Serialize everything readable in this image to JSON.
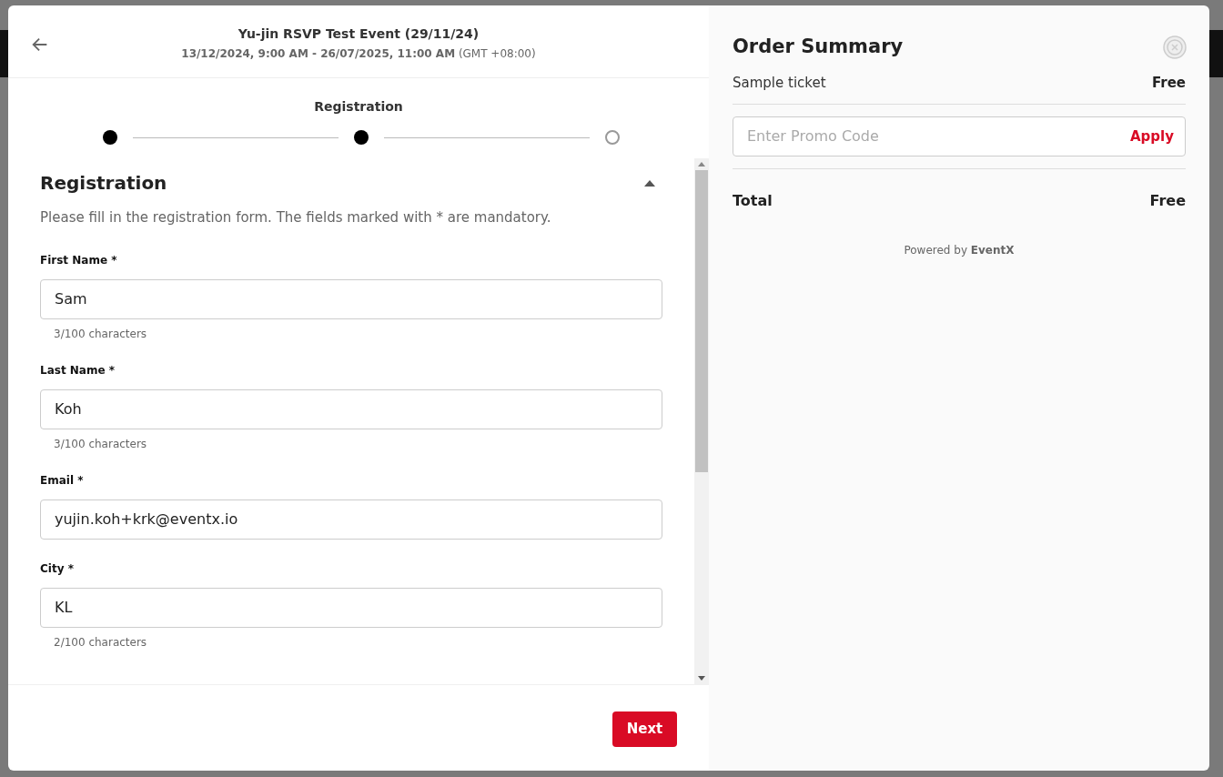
{
  "event": {
    "title": "Yu-jin RSVP Test Event (29/11/24)",
    "dates": "**13/12/2024, 9:00 AM - 26/07/2025, 11:00 AM** (GMT +08:00)"
  },
  "stepper": {
    "label": "Registration",
    "steps": [
      {
        "filled": true
      },
      {
        "filled": true
      },
      {
        "filled": false
      }
    ]
  },
  "section": {
    "title": "Registration",
    "expanded": true,
    "description": "Please fill in the registration form. The fields marked with * are mandatory.",
    "fields": [
      {
        "label": "First Name *",
        "value": "Sam",
        "counter": "3/100 characters"
      },
      {
        "label": "Last Name *",
        "value": "Koh",
        "counter": "3/100 characters"
      },
      {
        "label": "Email *",
        "value": "yujin.koh+krk@eventx.io"
      },
      {
        "label": "City *",
        "value": "KL",
        "counter": "2/100 characters"
      }
    ]
  },
  "next_button": "Next",
  "order_summary": {
    "title": "Order Summary",
    "items": [
      {
        "name": "Sample ticket",
        "price": "Free"
      }
    ],
    "promo": {
      "placeholder": "Enter Promo Code",
      "button": "Apply"
    },
    "total": {
      "label": "Total",
      "value": "Free"
    },
    "powered_by": "Powered by **EventX**"
  }
}
